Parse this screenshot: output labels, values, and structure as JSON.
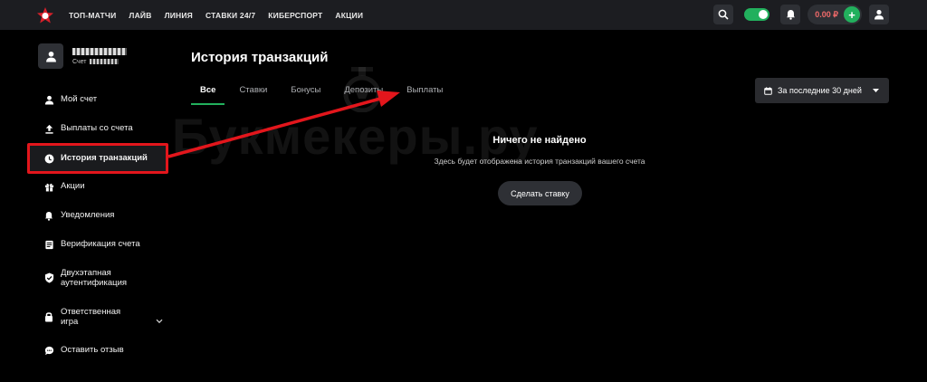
{
  "nav": {
    "items": [
      "ТОП-МАТЧИ",
      "ЛАЙВ",
      "ЛИНИЯ",
      "СТАВКИ 24/7",
      "КИБЕРСПОРТ",
      "АКЦИИ"
    ]
  },
  "header": {
    "balance": "0.00 ₽",
    "add_label": "+"
  },
  "profile": {
    "account_prefix": "Счет"
  },
  "sidebar": {
    "items": [
      {
        "label": "Мой счет",
        "icon": "user-icon"
      },
      {
        "label": "Выплаты со счета",
        "icon": "upload-icon"
      },
      {
        "label": "История транзакций",
        "icon": "clock-icon"
      },
      {
        "label": "Акции",
        "icon": "gift-icon"
      },
      {
        "label": "Уведомления",
        "icon": "bell-icon"
      },
      {
        "label": "Верификация счета",
        "icon": "document-icon"
      },
      {
        "label": "Двухэтапная\nаутентификация",
        "icon": "shield-icon"
      },
      {
        "label": "Ответственная\nигра",
        "icon": "lock-icon"
      },
      {
        "label": "Оставить отзыв",
        "icon": "chat-icon"
      }
    ]
  },
  "main": {
    "title": "История транзакций",
    "tabs": [
      "Все",
      "Ставки",
      "Бонусы",
      "Депозиты",
      "Выплаты"
    ],
    "date_filter": "За последние 30 дней",
    "empty_title": "Ничего не найдено",
    "empty_subtitle": "Здесь будет отображена история транзакций вашего счета",
    "cta_label": "Сделать ставку"
  },
  "watermark": "Букмекеры.ру",
  "colors": {
    "accent_green": "#22b05d",
    "highlight_red": "#e3161c",
    "balance_red": "#f06a6a"
  }
}
